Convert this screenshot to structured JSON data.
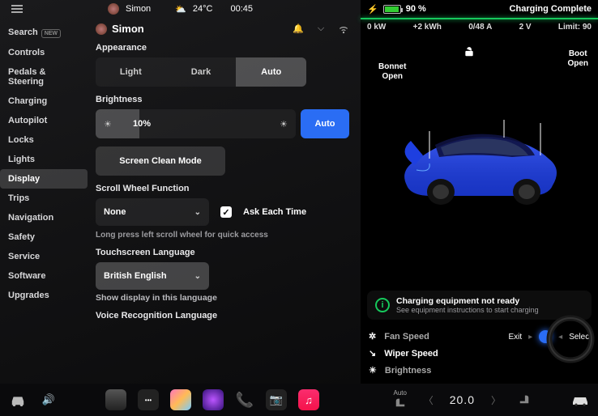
{
  "statusbar": {
    "user": "Simon",
    "temp": "24°C",
    "time": "00:45"
  },
  "sidebar": {
    "items": [
      {
        "label": "Search",
        "badge": "NEW"
      },
      {
        "label": "Controls"
      },
      {
        "label": "Pedals & Steering"
      },
      {
        "label": "Charging"
      },
      {
        "label": "Autopilot"
      },
      {
        "label": "Locks"
      },
      {
        "label": "Lights"
      },
      {
        "label": "Display",
        "active": true
      },
      {
        "label": "Trips"
      },
      {
        "label": "Navigation"
      },
      {
        "label": "Safety"
      },
      {
        "label": "Service"
      },
      {
        "label": "Software"
      },
      {
        "label": "Upgrades"
      }
    ]
  },
  "panel": {
    "user": "Simon",
    "appearance": {
      "label": "Appearance",
      "options": [
        "Light",
        "Dark",
        "Auto"
      ],
      "selected": "Auto"
    },
    "brightness": {
      "label": "Brightness",
      "value": "10%",
      "auto": "Auto"
    },
    "clean": "Screen Clean Mode",
    "scroll": {
      "label": "Scroll Wheel Function",
      "value": "None",
      "ask": "Ask Each Time",
      "hint": "Long press left scroll wheel for quick access"
    },
    "lang": {
      "label": "Touchscreen Language",
      "value": "British English",
      "sub": "Show display in this language"
    },
    "voice": {
      "label": "Voice Recognition Language"
    }
  },
  "right": {
    "battery": "90 %",
    "status": "Charging Complete",
    "stats": {
      "kw": "0 kW",
      "kwh": "+2 kWh",
      "amps": "0/48 A",
      "volts": "2 V",
      "limit": "Limit: 90"
    },
    "labels": {
      "bonnet": "Bonnet\nOpen",
      "boot": "Boot\nOpen"
    },
    "notice": {
      "t1": "Charging equipment not ready",
      "t2": "See equipment instructions to start charging"
    },
    "quick": {
      "fan": "Fan Speed",
      "wiper": "Wiper Speed",
      "bright": "Brightness",
      "exit": "Exit",
      "select": "Select"
    }
  },
  "dock": {
    "temp": "20.0",
    "seat": "Auto"
  }
}
